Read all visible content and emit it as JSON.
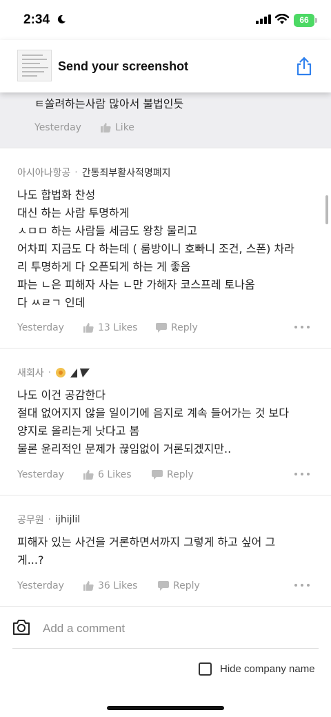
{
  "status_bar": {
    "time": "2:34",
    "battery": "66"
  },
  "banner": {
    "title": "Send your screenshot"
  },
  "previous_comment": {
    "text_tail": "ㅌ쏠려하는사람 많아서 불법인듯",
    "time": "Yesterday",
    "like_label": "Like"
  },
  "comments": [
    {
      "company": "아시아나항공",
      "nickname": "간통죄부활사적명폐지",
      "lines": [
        "나도 합법화 찬성",
        "대신 하는 사람 투명하게",
        "ㅅㅁㅁ 하는 사람들 세금도 왕창 물리고",
        "어차피 지금도 다 하는데 ( 룸방이니 호빠니 조건, 스폰) 차라",
        "리 투명하게 다 오픈되게 하는 게 좋음",
        "파는 ㄴ은 피해자 사는 ㄴ만 가해자 코스프레 토나옴",
        "다 ㅆㄹㄱ 인데"
      ],
      "time": "Yesterday",
      "likes": "13 Likes",
      "reply": "Reply"
    },
    {
      "company": "새회사",
      "nickname": "",
      "lines": [
        "나도 이건 공감한다",
        "절대 없어지지 않을 일이기에 음지로 계속 들어가는 것 보다",
        "양지로 올리는게 낫다고 봄",
        "물론 윤리적인 문제가 끊임없이 거론되겠지만.."
      ],
      "time": "Yesterday",
      "likes": "6 Likes",
      "reply": "Reply"
    },
    {
      "company": "공무원",
      "nickname": "ijhijlil",
      "lines": [
        "피해자 있는 사건을 거론하면서까지 그렇게 하고 싶어 그",
        "게...?"
      ],
      "time": "Yesterday",
      "likes": "36 Likes",
      "reply": "Reply"
    }
  ],
  "composer": {
    "placeholder": "Add a comment",
    "hide_company_label": "Hide company name"
  },
  "icons": [
    "moon-icon",
    "signal-icon",
    "wifi-icon",
    "battery-icon",
    "share-icon",
    "thumbs-up-icon",
    "speech-bubble-icon",
    "more-icon",
    "camera-icon"
  ],
  "colors": {
    "accent": "#2f80ed",
    "highlight_bg": "#eeeef1",
    "battery": "#4cd964"
  }
}
